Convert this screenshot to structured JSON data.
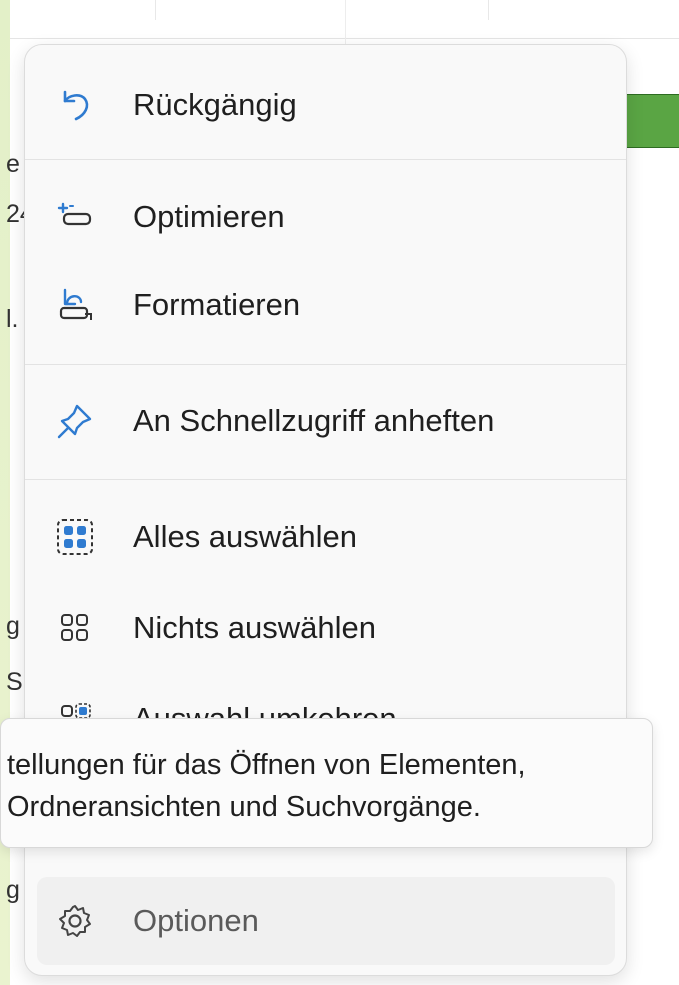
{
  "background": {
    "left_glyphs": [
      "e",
      "24",
      "l.",
      "g",
      "S",
      "g"
    ]
  },
  "menu": {
    "items": [
      {
        "label": "Rückgängig",
        "icon": "undo-icon"
      },
      {
        "label": "Optimieren",
        "icon": "optimize-icon"
      },
      {
        "label": "Formatieren",
        "icon": "format-icon"
      },
      {
        "label": "An Schnellzugriff anheften",
        "icon": "pin-icon"
      },
      {
        "label": "Alles auswählen",
        "icon": "select-all-icon"
      },
      {
        "label": "Nichts auswählen",
        "icon": "select-none-icon"
      },
      {
        "label": "Auswahl umkehren",
        "icon": "invert-selection-icon"
      },
      {
        "label": "Optionen",
        "icon": "gear-icon"
      }
    ]
  },
  "tooltip": {
    "line1": "tellungen für das Öffnen von Elementen,",
    "line2": "Ordneransichten und Suchvorgänge."
  },
  "colors": {
    "accent": "#2f7bd0",
    "green_block": "#5aa544"
  }
}
